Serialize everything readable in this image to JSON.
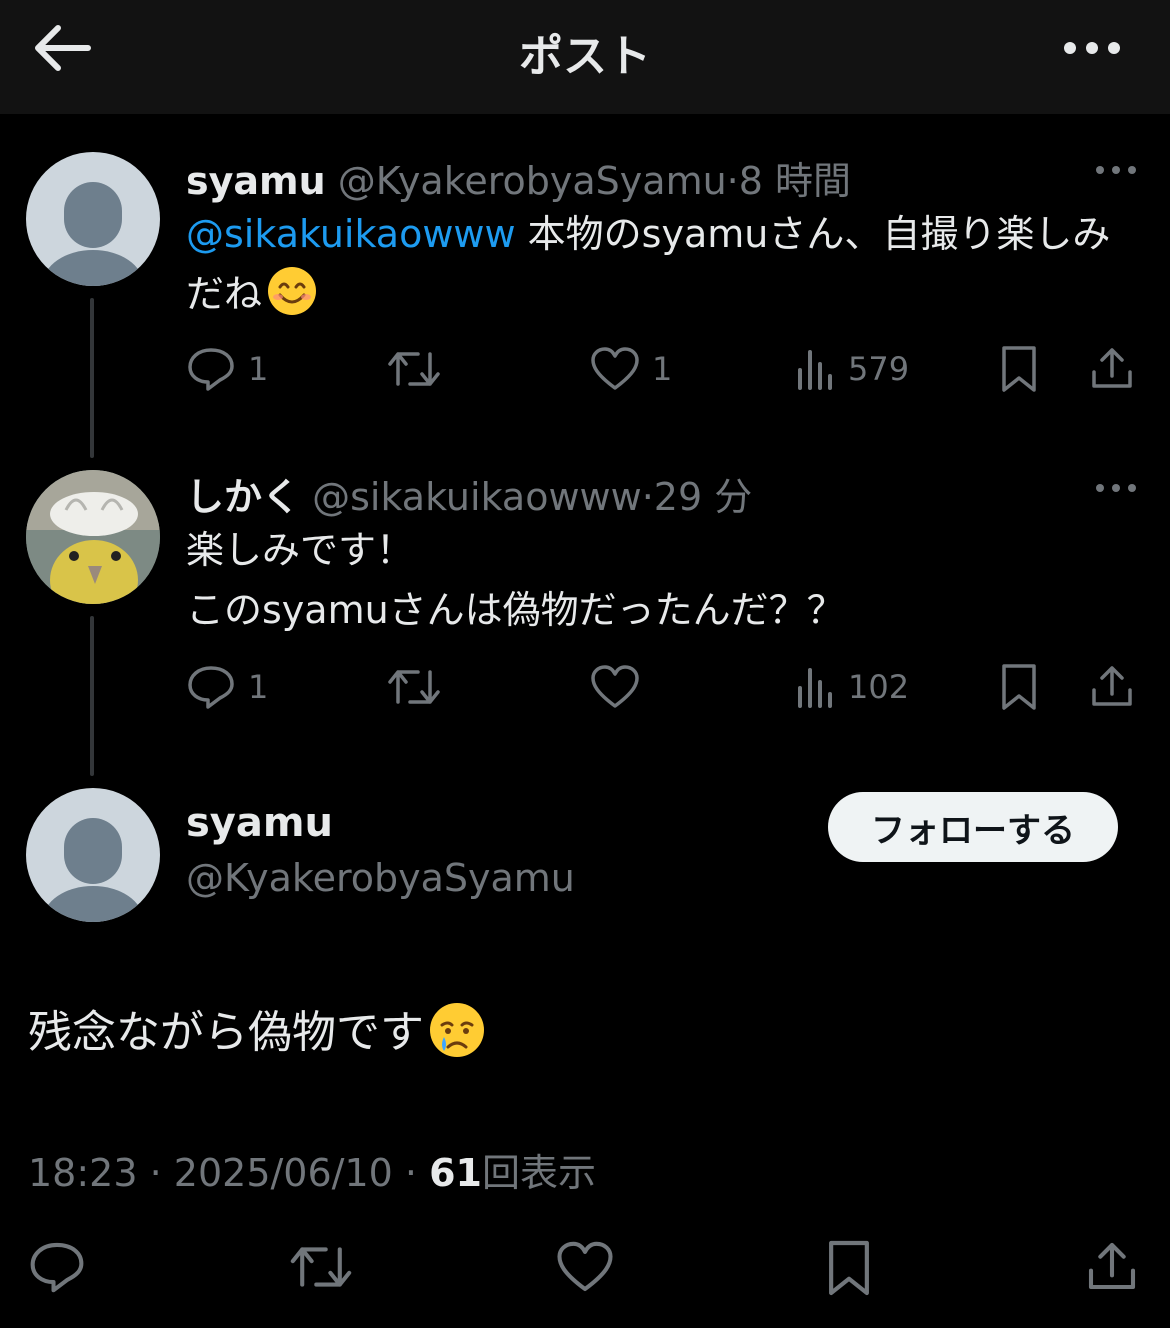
{
  "header": {
    "title": "ポスト",
    "back_icon": "arrow-left-icon",
    "more_icon": "more-horizontal-icon"
  },
  "tweets": [
    {
      "name": "syamu",
      "handle": "@KyakerobyaSyamu",
      "separator": "·",
      "time": "8 時間",
      "mention": "@sikakuikaowww",
      "text": " 本物のsyamuさん、自撮り楽しみだね",
      "emoji": "smiling-face-icon",
      "replies": "1",
      "retweets": "",
      "likes": "1",
      "views": "579"
    },
    {
      "name": "しかく",
      "handle": "@sikakuikaowww",
      "separator": "·",
      "time": "29 分",
      "line1": "楽しみです！",
      "line2": "このsyamuさんは偽物だったんだ？？",
      "replies": "1",
      "retweets": "",
      "likes": "",
      "views": "102"
    }
  ],
  "main_post": {
    "name": "syamu",
    "handle": "@KyakerobyaSyamu",
    "follow_label": "フォローする",
    "text": "残念ながら偽物です",
    "emoji": "crying-face-icon",
    "time": "18:23",
    "separator": "·",
    "date": "2025/06/10",
    "separator2": "·",
    "view_count": "61",
    "views_label": "回表示"
  },
  "colors": {
    "background": "#000000",
    "header": "#121212",
    "link": "#1d9bf0",
    "muted": "#71767b",
    "text": "#e7e9ea",
    "button": "#eff3f4"
  }
}
